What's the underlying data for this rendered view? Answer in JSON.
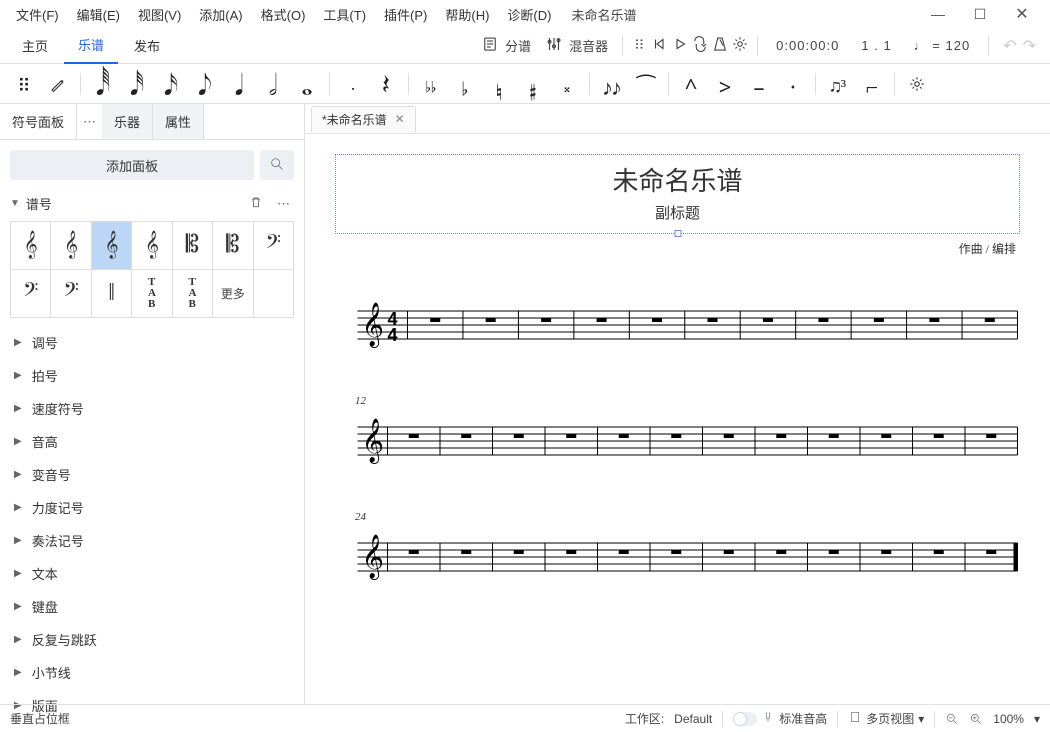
{
  "menu": {
    "items": [
      "文件(F)",
      "编辑(E)",
      "视图(V)",
      "添加(A)",
      "格式(O)",
      "工具(T)",
      "插件(P)",
      "帮助(H)",
      "诊断(D)"
    ],
    "doc_title": "未命名乐谱"
  },
  "main_tabs": {
    "home": "主页",
    "score": "乐谱",
    "publish": "发布"
  },
  "toolbar": {
    "parts": "分谱",
    "mixer": "混音器",
    "timecode": "0:00:00:0",
    "position": "1 . 1",
    "tempo_label": "♩ = 120"
  },
  "note_toolbar": {
    "durations": [
      "𝅘𝅥𝅱",
      "𝅘𝅥𝅰",
      "𝅘𝅥𝅯",
      "𝅘𝅥𝅮",
      "𝅘𝅥",
      "𝅗𝅥",
      "𝅝"
    ],
    "dot": "𝅭",
    "rest": "𝄽",
    "accidentals": [
      "♭♭",
      "♭",
      "♮",
      "♯",
      "𝄪"
    ],
    "ties": [
      "♪♪",
      "⁀"
    ],
    "articulations": [
      "^",
      ">",
      "–",
      "·"
    ],
    "tuplets": [
      "♫³",
      "⌐"
    ]
  },
  "left_panel": {
    "tabs": {
      "palette": "符号面板",
      "instruments": "乐器",
      "properties": "属性"
    },
    "add_panel": "添加面板",
    "sections": {
      "clefs": {
        "label": "谱号",
        "cells": [
          "𝄞",
          "𝄞",
          "𝄞",
          "𝄞",
          "𝄡",
          "𝄡",
          "𝄢",
          "𝄢",
          "𝄢",
          "‖",
          "TAB",
          "TAB",
          "更多"
        ]
      },
      "others": [
        "调号",
        "拍号",
        "速度符号",
        "音高",
        "变音号",
        "力度记号",
        "奏法记号",
        "文本",
        "键盘",
        "反复与跳跃",
        "小节线",
        "版面"
      ]
    }
  },
  "document": {
    "tab_label": "*未命名乐谱",
    "title": "未命名乐谱",
    "subtitle": "副标题",
    "composer": "作曲 / 编排",
    "systems": [
      {
        "label": "",
        "measures": 11,
        "show_timesig": true
      },
      {
        "label": "12",
        "measures": 12,
        "show_timesig": false
      },
      {
        "label": "24",
        "measures": 12,
        "show_timesig": false,
        "final_bar": true
      }
    ]
  },
  "statusbar": {
    "left": "垂直占位框",
    "workspace_label": "工作区:",
    "workspace_value": "Default",
    "concert_pitch": "标准音高",
    "view_mode": "多页视图",
    "zoom": "100%"
  }
}
